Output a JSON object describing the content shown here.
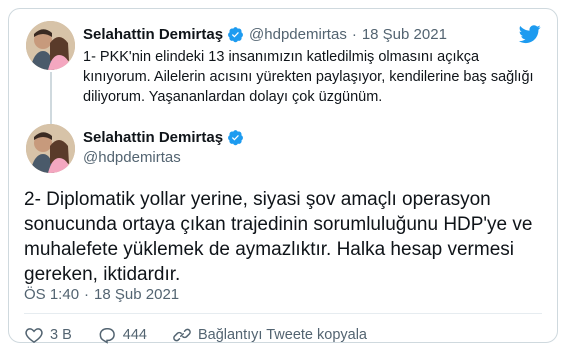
{
  "brand_color": "#1d9bf0",
  "reply_tweet": {
    "author_name": "Selahattin Demirtaş",
    "handle": "@hdpdemirtas",
    "separator": "·",
    "date": "18 Şub 2021",
    "text": "1- PKK'nin elindeki 13 insanımızın katledilmiş olmasını açıkça kınıyorum. Ailelerin acısını yürekten paylaşıyor, kendilerine baş sağlığı diliyorum. Yaşananlardan dolayı çok üzgünüm."
  },
  "main_tweet": {
    "author_name": "Selahattin Demirtaş",
    "handle": "@hdpdemirtas",
    "text": "2- Diplomatik yollar yerine, siyasi şov amaçlı operasyon sonucunda ortaya çıkan trajedinin sorumluluğunu HDP'ye ve muhalefete yüklemek de aymazlıktır. Halka hesap vermesi gereken, iktidardır.",
    "time": "ÖS 1:40",
    "separator": "·",
    "date": "18 Şub 2021"
  },
  "actions": {
    "likes": "3 B",
    "replies": "444",
    "copy_link": "Bağlantıyı Tweete kopyala"
  },
  "icons": [
    "twitter-bird-icon",
    "verified-badge-icon",
    "heart-icon",
    "reply-icon",
    "link-icon"
  ]
}
